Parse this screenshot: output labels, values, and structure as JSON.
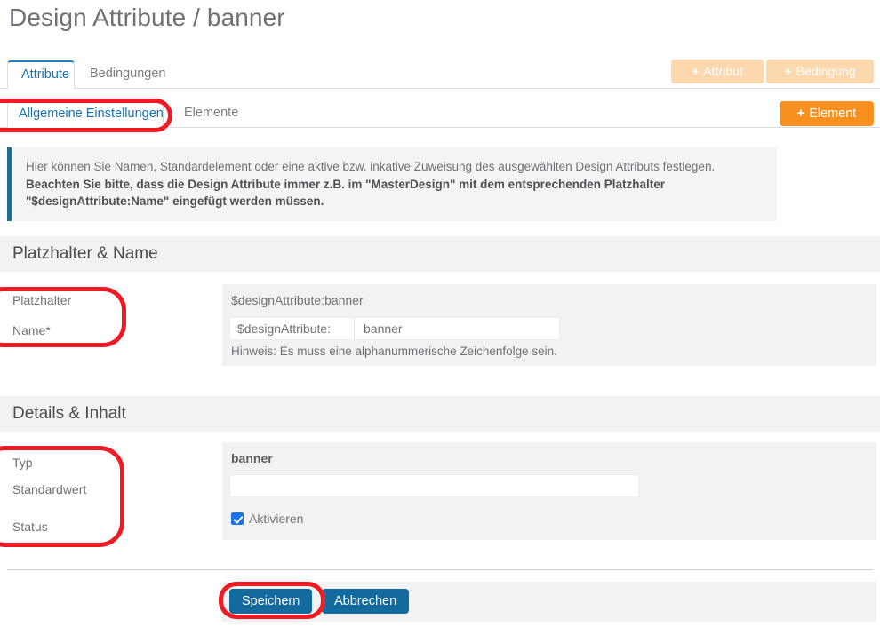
{
  "page": {
    "title": "Design Attribute / banner"
  },
  "tabs_outer": [
    {
      "label": "Attribute",
      "active": true
    },
    {
      "label": "Bedingungen",
      "active": false
    }
  ],
  "tabs_inner": [
    {
      "label": "Allgemeine Einstellungen",
      "active": true
    },
    {
      "label": "Elemente",
      "active": false
    }
  ],
  "toolbar": {
    "add_attribut_label": "Attribut",
    "add_bedingung_label": "Bedingung",
    "add_element_label": "Element",
    "plus_glyph": "+",
    "disabled_color": "#fbd8ad",
    "active_color": "#f7901e"
  },
  "infobox": {
    "line1": "Hier können Sie Namen, Standardelement oder eine aktive bzw. inkative Zuweisung des ausgewählten Design Attributs festlegen.",
    "line2": "Beachten Sie bitte, dass die Design Attribute immer z.B. im \"MasterDesign\" mit dem entsprechenden Platzhalter",
    "line3": "\"$designAttribute:Name\" eingefügt werden müssen.",
    "accent_color": "#1d6c8c"
  },
  "section_platzhalter": {
    "heading": "Platzhalter & Name",
    "labels": {
      "platzhalter": "Platzhalter",
      "name": "Name*"
    },
    "preview_value": "$designAttribute:banner",
    "input_prefix": "$designAttribute:",
    "input_value": "banner",
    "help_text": "Hinweis: Es muss eine alphanummerische Zeichenfolge sein."
  },
  "section_details": {
    "heading": "Details & Inhalt",
    "labels": {
      "typ": "Typ",
      "standardwert": "Standardwert",
      "status": "Status"
    },
    "field_title": "banner",
    "field_value": "",
    "field_placeholder": "",
    "checkbox_label": "Aktivieren",
    "checkbox_checked": true,
    "checkbox_color": "#1a73e8"
  },
  "footer": {
    "save_label": "Speichern",
    "cancel_label": "Abbrechen",
    "button_color": "#136a9f"
  },
  "annotations": {
    "color": "#ee1b24",
    "items": [
      "allgemeine-einstellungen-tab",
      "platzhalter-name-labels",
      "typ-standardwert-status-labels",
      "speichern-button"
    ]
  }
}
